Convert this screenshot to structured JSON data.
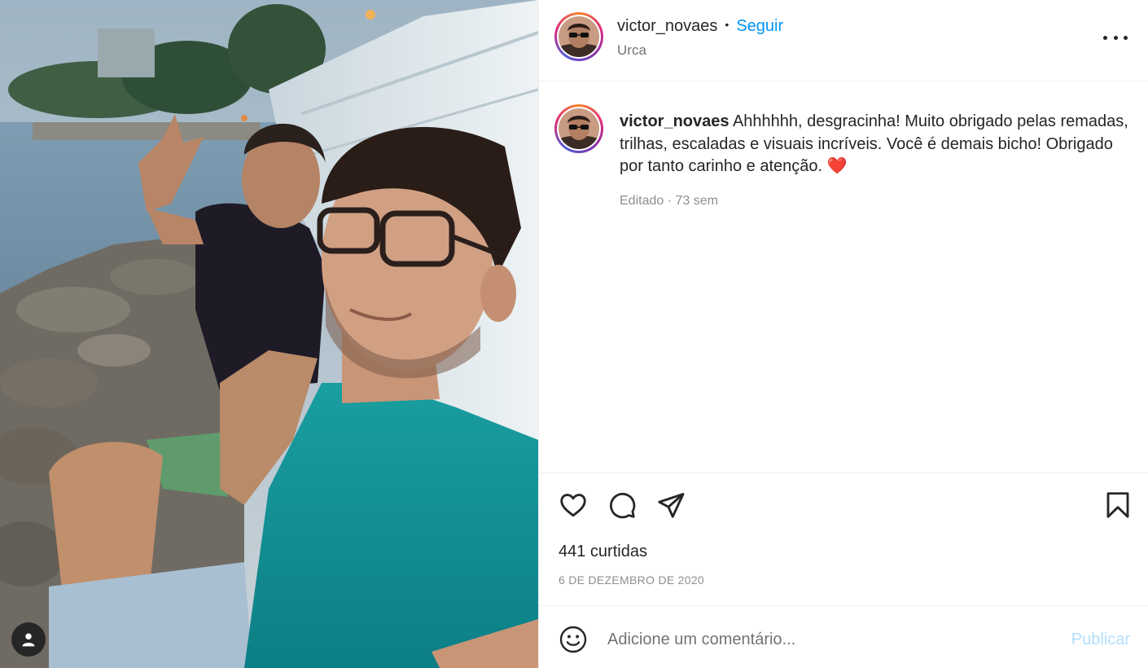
{
  "post": {
    "username": "victor_novaes",
    "separator": "•",
    "follow_label": "Seguir",
    "location": "Urca",
    "caption": {
      "username": "victor_novaes",
      "text": "Ahhhhhh, desgracinha! Muito obrigado pelas remadas, trilhas, escaladas e visuais incríveis. Você é demais bicho! Obrigado por tanto carinho e atenção.",
      "emoji": "❤️"
    },
    "caption_meta": "Editado · 73 sem",
    "likes": "441 curtidas",
    "date": "6 DE DEZEMBRO DE 2020"
  },
  "comment": {
    "placeholder": "Adicione um comentário...",
    "publish_label": "Publicar"
  },
  "icons": {
    "more": "more-options-icon",
    "like": "heart-icon",
    "comment": "comment-icon",
    "share": "share-icon",
    "save": "bookmark-icon",
    "emoji": "emoji-icon",
    "user_tag": "user-icon"
  },
  "colors": {
    "accent_blue": "#0095f6",
    "publish_disabled": "#b2dffc",
    "text": "#262626",
    "secondary_text": "#8e8e8e",
    "divider": "#efefef"
  }
}
